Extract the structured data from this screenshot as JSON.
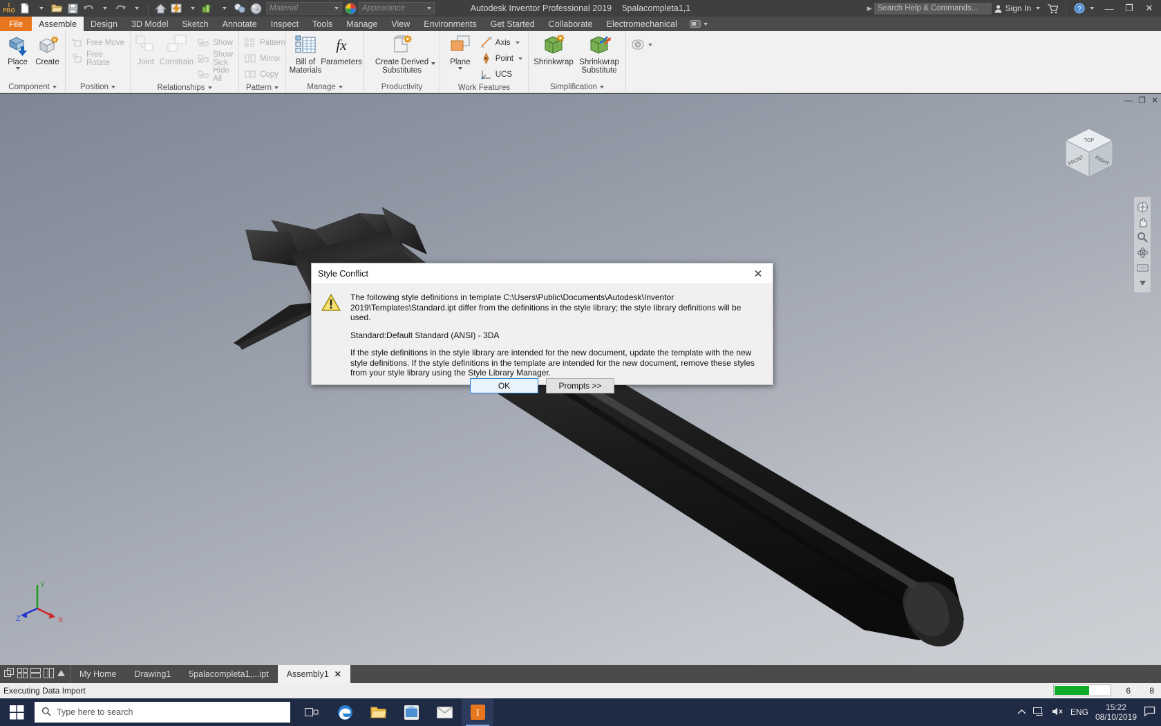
{
  "titlebar": {
    "app_title": "Autodesk Inventor Professional 2019",
    "doc_title": "5palacompleta1,1",
    "material_placeholder": "Material",
    "appearance_placeholder": "Appearance",
    "search_placeholder": "Search Help & Commands...",
    "sign_in": "Sign In",
    "help_label": "?",
    "minimize": "—",
    "maximize": "❐",
    "close": "✕"
  },
  "ribbon_tabs": [
    {
      "label": "File",
      "kind": "file"
    },
    {
      "label": "Assemble",
      "kind": "active"
    },
    {
      "label": "Design",
      "kind": "normal"
    },
    {
      "label": "3D Model",
      "kind": "normal"
    },
    {
      "label": "Sketch",
      "kind": "normal"
    },
    {
      "label": "Annotate",
      "kind": "normal"
    },
    {
      "label": "Inspect",
      "kind": "normal"
    },
    {
      "label": "Tools",
      "kind": "normal"
    },
    {
      "label": "Manage",
      "kind": "normal"
    },
    {
      "label": "View",
      "kind": "normal"
    },
    {
      "label": "Environments",
      "kind": "normal"
    },
    {
      "label": "Get Started",
      "kind": "normal"
    },
    {
      "label": "Collaborate",
      "kind": "normal"
    },
    {
      "label": "Electromechanical",
      "kind": "normal"
    }
  ],
  "ribbon": {
    "panels": [
      {
        "title": "Component",
        "big": [
          {
            "label": "Place",
            "icon": "place-component-icon",
            "has_dropdown": true
          },
          {
            "label": "Create",
            "icon": "create-component-icon",
            "has_dropdown": false
          }
        ],
        "small": []
      },
      {
        "title": "Position",
        "big": [],
        "small": [
          {
            "label": "Free Move",
            "icon": "free-move-icon",
            "disabled": true
          },
          {
            "label": "Free Rotate",
            "icon": "free-rotate-icon",
            "disabled": true
          }
        ]
      },
      {
        "title": "Relationships",
        "big": [
          {
            "label": "Joint",
            "icon": "joint-icon",
            "disabled": true
          },
          {
            "label": "Constrain",
            "icon": "constrain-icon",
            "disabled": true
          }
        ],
        "small": [
          {
            "label": "Show",
            "icon": "show-relationships-icon",
            "disabled": true
          },
          {
            "label": "Show Sick",
            "icon": "show-sick-icon",
            "disabled": true
          },
          {
            "label": "Hide All",
            "icon": "hide-all-icon",
            "disabled": true
          }
        ]
      },
      {
        "title": "Pattern",
        "big": [],
        "small": [
          {
            "label": "Pattern",
            "icon": "pattern-icon",
            "disabled": true
          },
          {
            "label": "Mirror",
            "icon": "mirror-icon",
            "disabled": true
          },
          {
            "label": "Copy",
            "icon": "copy-icon",
            "disabled": true
          }
        ]
      },
      {
        "title": "Manage",
        "big": [
          {
            "label": "Bill of Materials",
            "icon": "bill-of-materials-icon"
          },
          {
            "label": "Parameters",
            "icon": "parameters-fx-icon"
          }
        ],
        "small": []
      },
      {
        "title": "Productivity",
        "big": [
          {
            "label": "Create Derived Substitutes",
            "icon": "create-derived-substitutes-icon",
            "has_dropdown": true
          }
        ],
        "small": []
      },
      {
        "title": "Work Features",
        "big": [
          {
            "label": "Plane",
            "icon": "work-plane-icon",
            "has_dropdown": true
          }
        ],
        "small": [
          {
            "label": "Axis",
            "icon": "work-axis-icon",
            "has_dropdown": true
          },
          {
            "label": "Point",
            "icon": "work-point-icon",
            "has_dropdown": true
          },
          {
            "label": "UCS",
            "icon": "ucs-icon"
          }
        ]
      },
      {
        "title": "Simplification",
        "big": [
          {
            "label": "Shrinkwrap",
            "icon": "shrinkwrap-icon"
          },
          {
            "label": "Shrinkwrap Substitute",
            "icon": "shrinkwrap-substitute-icon"
          }
        ],
        "small": []
      }
    ]
  },
  "viewport": {
    "viewcube_faces": {
      "top": "TOP",
      "front": "FRONT",
      "right": "RIGHT"
    },
    "triad_labels": {
      "x": "X",
      "y": "Y",
      "z": "Z"
    },
    "nav_icons": [
      "full-navigation-wheel-icon",
      "pan-icon",
      "zoom-icon",
      "orbit-icon",
      "look-at-icon"
    ],
    "window_buttons": {
      "minimize": "—",
      "restore": "❐",
      "close": "✕"
    }
  },
  "dialog": {
    "title": "Style Conflict",
    "close_label": "✕",
    "icon": "warning-triangle-icon",
    "paragraph1": "The following style definitions in template C:\\Users\\Public\\Documents\\Autodesk\\Inventor 2019\\Templates\\Standard.ipt differ from the definitions in the style library; the style library definitions will be used.",
    "paragraph2": "Standard:Default Standard (ANSI) - 3DA",
    "paragraph3": "If the style definitions in the style library are intended for the new document, update the template with the new style definitions. If the style definitions in the template are intended for the new document, remove these styles from your style library using the Style Library Manager.",
    "ok_label": "OK",
    "prompts_label": "Prompts >>"
  },
  "doctabs": {
    "view_icons": [
      "tile-all-icon",
      "grid-view-icon",
      "horizontal-split-icon",
      "vertical-split-icon",
      "collapse-up-icon"
    ],
    "tabs": [
      {
        "label": "My Home",
        "active": false,
        "closable": false
      },
      {
        "label": "Drawing1",
        "active": false,
        "closable": false
      },
      {
        "label": "5palacompleta1,...ipt",
        "active": false,
        "closable": false
      },
      {
        "label": "Assembly1",
        "active": true,
        "closable": true,
        "close_label": "✕"
      }
    ]
  },
  "statusbar": {
    "message": "Executing Data Import",
    "progress_percent": 62,
    "progress_color": "#0cab28",
    "count_left": "6",
    "count_right": "8"
  },
  "taskbar": {
    "start_icon": "windows-start-icon",
    "search_placeholder": "Type here to search",
    "search_icon": "search-icon",
    "apps": [
      {
        "name": "task-view-icon",
        "active": false
      },
      {
        "name": "edge-browser-icon",
        "active": false
      },
      {
        "name": "file-explorer-icon",
        "active": false
      },
      {
        "name": "microsoft-store-icon",
        "active": false
      },
      {
        "name": "mail-icon",
        "active": false
      },
      {
        "name": "inventor-app-icon",
        "active": true
      }
    ],
    "tray": {
      "show_hidden_icon": "chevron-up-icon",
      "network_icon": "network-icon",
      "volume_icon": "volume-muted-icon",
      "language": "ENG",
      "time": "15:22",
      "date": "08/10/2019",
      "notifications_icon": "notification-icon"
    }
  },
  "colors": {
    "accent_orange": "#e8761e",
    "ribbon_bg": "#f1f1f1",
    "titlebar_bg": "#3f3f3f",
    "taskbar_bg": "#1f2a44",
    "progress_green": "#0cab28",
    "dialog_bg": "#f0f0f0"
  }
}
